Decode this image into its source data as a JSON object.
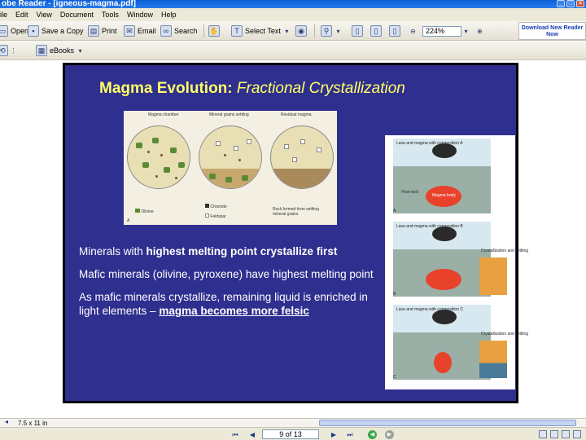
{
  "window": {
    "title": "obe Reader - [igneous-magma.pdf]"
  },
  "menu": [
    "ile",
    "Edit",
    "View",
    "Document",
    "Tools",
    "Window",
    "Help"
  ],
  "toolbar": {
    "open": "Open",
    "save_copy": "Save a Copy",
    "print": "Print",
    "email": "Email",
    "search": "Search",
    "select_text": "Select Text",
    "zoom": "224%",
    "download_line1": "Download New Reader",
    "download_line2": "Now"
  },
  "toolbar2": {
    "ebooks": "eBooks"
  },
  "slide": {
    "title_bold": "Magma Evolution:",
    "title_italic": " Fractional Crystallization",
    "fig_a": {
      "label_chamber": "Magma chamber",
      "label_grains": "Mineral grains settling",
      "label_residual": "Residual magma",
      "legend_olivine": "Olivine",
      "legend_chromite": "Chromite",
      "legend_feldspar": "Feldspar",
      "label_rock": "Rock formed from settling mineral grains",
      "letter": "A"
    },
    "fig_b": {
      "panel1_label": "Lava and magma with composition A",
      "panel1_host": "Host rock",
      "panel1_magma": "Magma body",
      "panel1_letter": "A",
      "panel2_label": "Lava and magma with composition B",
      "panel2_inset": "Crystallization and settling",
      "panel2_letter": "B",
      "panel3_label": "Lava and magma with composition C",
      "panel3_inset": "Crystallization and settling",
      "panel3_letter": "C"
    },
    "bullet1_pre": "Minerals with ",
    "bullet1_bold": "highest melting point crystallize first",
    "bullet2": "Mafic minerals (olivine, pyroxene) have highest melting point",
    "bullet3_pre": "As mafic minerals crystallize, remaining liquid is enriched in light elements – ",
    "bullet3_link": "magma becomes more felsic"
  },
  "status": {
    "page_size": "7.5 x 11 in",
    "page_indicator": "9 of 13"
  }
}
